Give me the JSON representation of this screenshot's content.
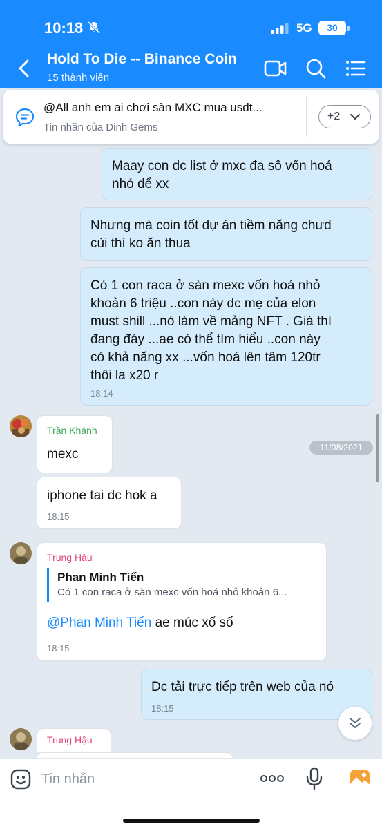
{
  "status_bar": {
    "time": "10:18",
    "network": "5G",
    "battery": "30"
  },
  "header": {
    "title": "Hold To Die -- Binance Coin",
    "subtitle": "15 thành viên"
  },
  "pinned": {
    "text": "@All  anh em ai chơi sàn MXC mua usdt...",
    "sender": "Tin nhắn của Dinh Gems",
    "more_label": "+2"
  },
  "messages": [
    {
      "type": "out",
      "lines": [
        "Maay con dc list ở mxc đa số vốn hoá",
        "nhỏ dể xx"
      ]
    },
    {
      "type": "out",
      "lines": [
        "Nhưng mà coin tốt dự án tiềm năng chưd",
        "cùi thì ko ăn thua"
      ]
    },
    {
      "type": "out",
      "lines": [
        "Có 1 con raca ở sàn mexc vốn hoá nhỏ",
        "khoản 6 triệu ..con này dc mẹ của elon",
        "must shill ...nó làm về mảng NFT . Giá thì",
        "đang đáy ...ae có thể tìm hiểu ..con này",
        "có khả năng xx ...vốn hoá lên tâm 120tr",
        "thôi la x20 r"
      ],
      "time": "18:14"
    },
    {
      "type": "in",
      "sender": "Trần Khánh",
      "text": "mexc"
    },
    {
      "type": "in",
      "text": "iphone tai dc hok a",
      "time": "18:15"
    },
    {
      "type": "in",
      "sender": "Trung Hậu",
      "quote_name": "Phan Minh Tiến",
      "quote_text": "Có 1 con raca ở sàn mexc vốn hoá nhỏ khoản 6...",
      "mention": "@Phan Minh Tiến",
      "text": " ae múc xổ số",
      "time": "18:15"
    },
    {
      "type": "out",
      "lines": [
        "Dc tải trực tiếp trên web của nó"
      ],
      "time": "18:15"
    },
    {
      "type": "in",
      "sender": "Trung Hậu"
    }
  ],
  "date_badge": "11/08/2021",
  "composer": {
    "placeholder": "Tin nhắn"
  },
  "colors": {
    "header_bg": "#1a8bff",
    "outgoing_bubble": "#d4ecfc",
    "incoming_bubble": "#ffffff",
    "sender_green": "#3aa757",
    "sender_pink": "#e0457b",
    "mention": "#1a8bff"
  }
}
